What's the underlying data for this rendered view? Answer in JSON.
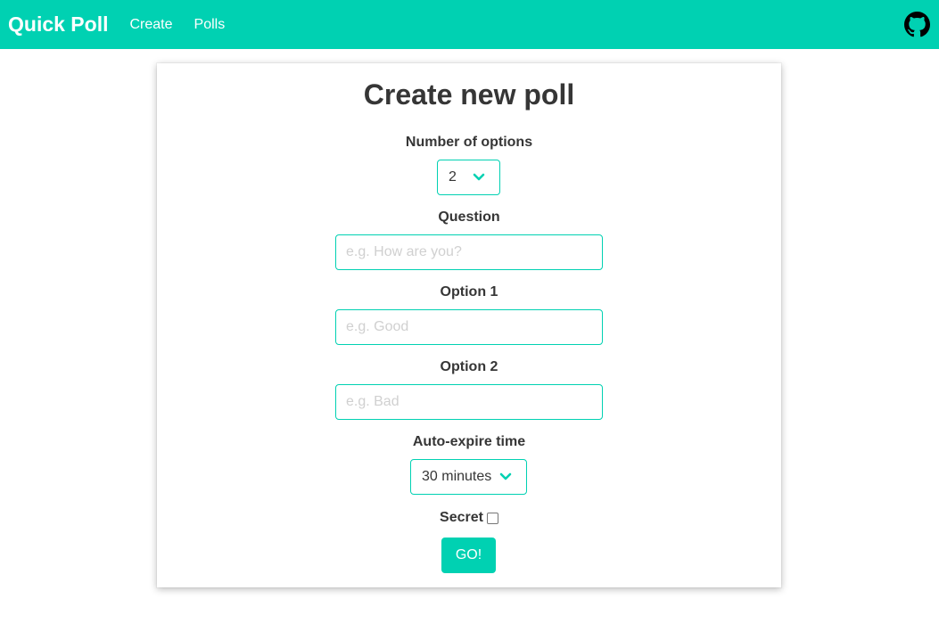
{
  "navbar": {
    "brand": "Quick Poll",
    "links": [
      "Create",
      "Polls"
    ],
    "github_icon": "github-icon"
  },
  "form": {
    "title": "Create new poll",
    "num_options_label": "Number of options",
    "num_options_value": "2",
    "question_label": "Question",
    "question_placeholder": "e.g. How are you?",
    "option1_label": "Option 1",
    "option1_placeholder": "e.g. Good",
    "option2_label": "Option 2",
    "option2_placeholder": "e.g. Bad",
    "expire_label": "Auto-expire time",
    "expire_value": "30 minutes",
    "secret_label": "Secret",
    "secret_checked": false,
    "submit_label": "GO!"
  },
  "colors": {
    "accent": "#00d1b2",
    "text": "#363636",
    "placeholder": "#d0d0d0"
  }
}
